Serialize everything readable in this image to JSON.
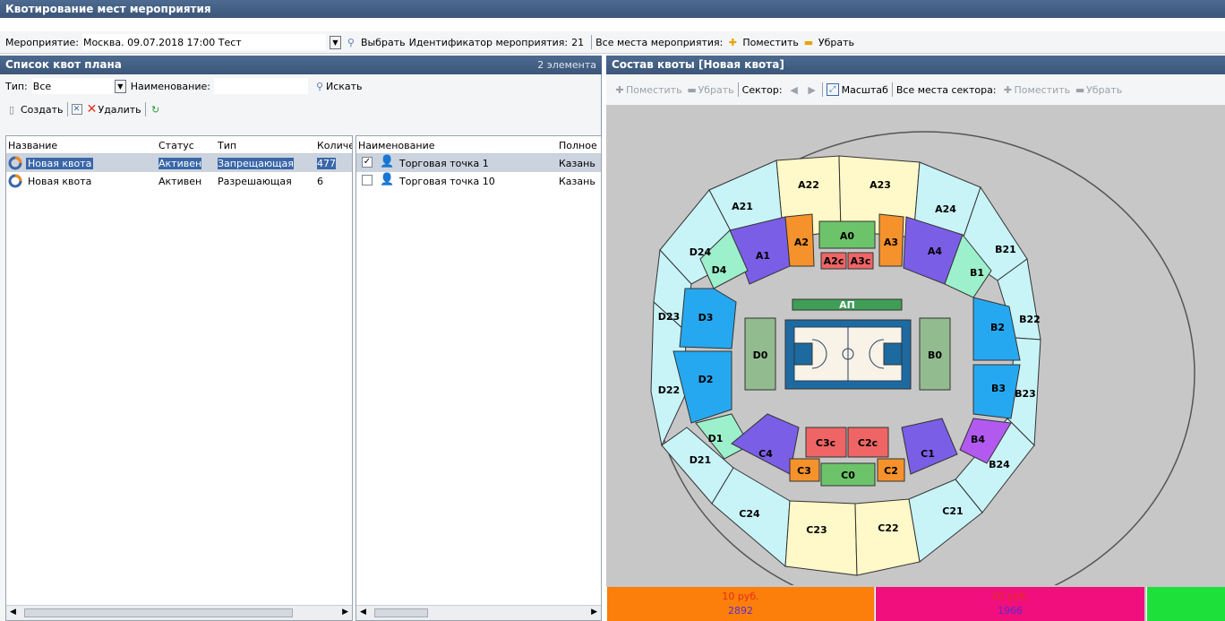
{
  "window": {
    "title": "Квотирование мест мероприятия"
  },
  "event_bar": {
    "event_label": "Мероприятие:",
    "event_value": "Москва. 09.07.2018 17:00 Тест",
    "select_label": "Выбрать",
    "id_label": "Идентификатор мероприятия:",
    "id_value": "21",
    "all_seats_label": "Все места мероприятия:",
    "place_label": "Поместить",
    "remove_label": "Убрать"
  },
  "left_panel": {
    "title": "Список квот плана",
    "count": "2 элемента",
    "filter": {
      "type_label": "Тип:",
      "type_value": "Все",
      "name_label": "Наименование:",
      "name_value": "",
      "search_label": "Искать"
    },
    "toolbar": {
      "create_label": "Создать",
      "delete_label": "Удалить"
    },
    "quota_table": {
      "columns": [
        "Название",
        "Статус",
        "Тип",
        "Количе"
      ],
      "rows": [
        {
          "name": "Новая квота",
          "status": "Активен",
          "type": "Запрещающая",
          "count": "477"
        },
        {
          "name": "Новая квота",
          "status": "Активен",
          "type": "Разрешающая",
          "count": "6"
        }
      ]
    },
    "points_table": {
      "columns": [
        "Наименование",
        "Полное"
      ],
      "rows": [
        {
          "name": "Торговая точка 1",
          "full": "Казань",
          "checked": true
        },
        {
          "name": "Торговая точка 10",
          "full": "Казань",
          "checked": false
        }
      ]
    }
  },
  "right_panel": {
    "title": "Состав квоты [Новая квота]",
    "toolbar": {
      "place_label": "Поместить",
      "remove_label": "Убрать",
      "sector_label": "Сектор:",
      "scale_label": "Масштаб",
      "sector_seats_label": "Все места сектора:",
      "place2_label": "Поместить",
      "remove2_label": "Убрать"
    },
    "map": {
      "sectors": {
        "A0": "A0",
        "A1": "A1",
        "A2": "A2",
        "A3": "A3",
        "A4": "A4",
        "A2c": "A2c",
        "A3c": "A3c",
        "A21": "A21",
        "A22": "A22",
        "A23": "A23",
        "A24": "A24",
        "B0": "B0",
        "B1": "B1",
        "B2": "B2",
        "B3": "B3",
        "B4": "B4",
        "B21": "B21",
        "B22": "B22",
        "B23": "B23",
        "B24": "B24",
        "C0": "C0",
        "C1": "C1",
        "C2": "C2",
        "C3": "C3",
        "C4": "C4",
        "C2c": "C2c",
        "C3c": "C3c",
        "C21": "C21",
        "C22": "C22",
        "C23": "C23",
        "C24": "C24",
        "D0": "D0",
        "D1": "D1",
        "D2": "D2",
        "D3": "D3",
        "D4": "D4",
        "D21": "D21",
        "D22": "D22",
        "D23": "D23",
        "D24": "D24",
        "AP": "АП"
      }
    },
    "prices": [
      {
        "price": "10 руб.",
        "count": "2892",
        "color": "#fb7f0a"
      },
      {
        "price": "20 руб.",
        "count": "1966",
        "color": "#f00f7c"
      },
      {
        "price": "",
        "count": "",
        "color": "#1ee03b"
      }
    ]
  }
}
